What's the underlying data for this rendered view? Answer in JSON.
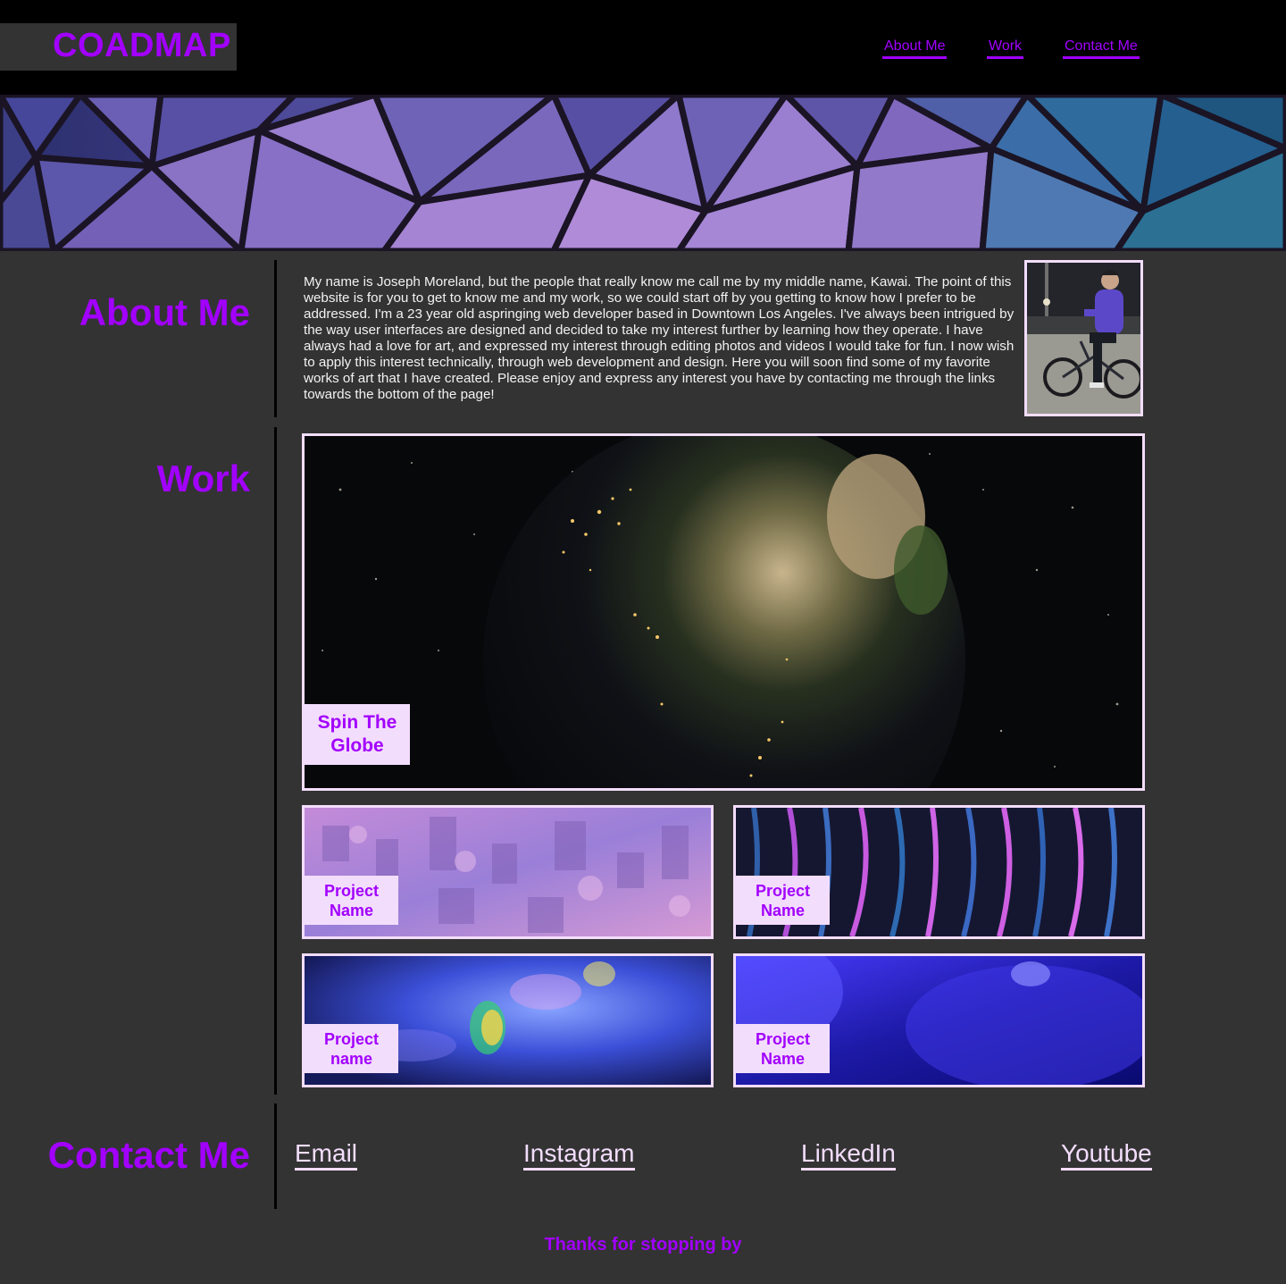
{
  "header": {
    "logo": "COADMAP",
    "nav": [
      "About Me",
      "Work",
      "Contact Me"
    ]
  },
  "about": {
    "title": "About Me",
    "text": "My name is Joseph Moreland, but the people that really know me call me by my middle name, Kawai. The point of this website is for you to get to know me and my work, so we could start off by you getting to know how I prefer to be addressed. I'm a 23 year old aspringing web developer based in Downtown Los Angeles. I've always been intrigued by the way user interfaces are designed and decided to take my interest further by learning how they operate. I have always had a love for art, and expressed my interest through editing photos and videos I would take for fun. I now wish to apply this interest technically, through web development and design. Here you will soon find some of my favorite works of art that I have created. Please enjoy and express any interest you have by contacting me through the links towards the bottom of the page!"
  },
  "work": {
    "title": "Work",
    "featured": {
      "line1": "Spin The",
      "line2": "Globe"
    },
    "projects": [
      {
        "line1": "Project",
        "line2": "Name"
      },
      {
        "line1": "Project",
        "line2": "Name"
      },
      {
        "line1": "Project",
        "line2": "name"
      },
      {
        "line1": "Project",
        "line2": "Name"
      }
    ]
  },
  "contact": {
    "title": "Contact Me",
    "links": [
      "Email",
      "Instagram",
      "LinkedIn",
      "Youtube"
    ]
  },
  "footer": {
    "text": "Thanks for stopping by"
  },
  "colors": {
    "accent": "#a200ff",
    "label_bg": "#f3ddfc",
    "page_bg": "#333333",
    "header_bg": "#000000"
  }
}
